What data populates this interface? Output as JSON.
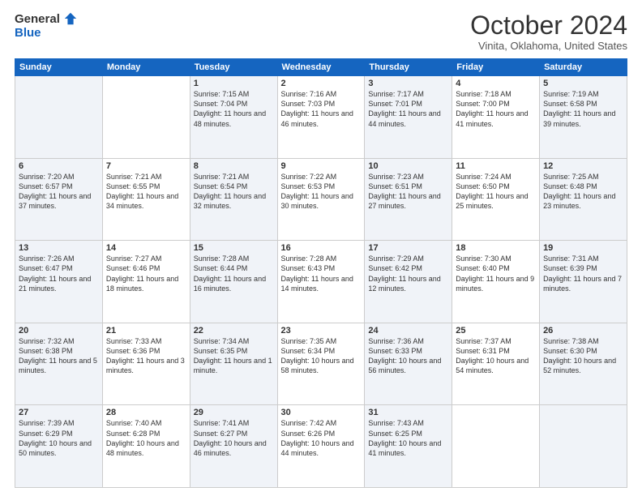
{
  "header": {
    "logo_general": "General",
    "logo_blue": "Blue",
    "title": "October 2024",
    "location": "Vinita, Oklahoma, United States"
  },
  "days_of_week": [
    "Sunday",
    "Monday",
    "Tuesday",
    "Wednesday",
    "Thursday",
    "Friday",
    "Saturday"
  ],
  "weeks": [
    [
      {
        "day": "",
        "info": ""
      },
      {
        "day": "",
        "info": ""
      },
      {
        "day": "1",
        "info": "Sunrise: 7:15 AM\nSunset: 7:04 PM\nDaylight: 11 hours and 48 minutes."
      },
      {
        "day": "2",
        "info": "Sunrise: 7:16 AM\nSunset: 7:03 PM\nDaylight: 11 hours and 46 minutes."
      },
      {
        "day": "3",
        "info": "Sunrise: 7:17 AM\nSunset: 7:01 PM\nDaylight: 11 hours and 44 minutes."
      },
      {
        "day": "4",
        "info": "Sunrise: 7:18 AM\nSunset: 7:00 PM\nDaylight: 11 hours and 41 minutes."
      },
      {
        "day": "5",
        "info": "Sunrise: 7:19 AM\nSunset: 6:58 PM\nDaylight: 11 hours and 39 minutes."
      }
    ],
    [
      {
        "day": "6",
        "info": "Sunrise: 7:20 AM\nSunset: 6:57 PM\nDaylight: 11 hours and 37 minutes."
      },
      {
        "day": "7",
        "info": "Sunrise: 7:21 AM\nSunset: 6:55 PM\nDaylight: 11 hours and 34 minutes."
      },
      {
        "day": "8",
        "info": "Sunrise: 7:21 AM\nSunset: 6:54 PM\nDaylight: 11 hours and 32 minutes."
      },
      {
        "day": "9",
        "info": "Sunrise: 7:22 AM\nSunset: 6:53 PM\nDaylight: 11 hours and 30 minutes."
      },
      {
        "day": "10",
        "info": "Sunrise: 7:23 AM\nSunset: 6:51 PM\nDaylight: 11 hours and 27 minutes."
      },
      {
        "day": "11",
        "info": "Sunrise: 7:24 AM\nSunset: 6:50 PM\nDaylight: 11 hours and 25 minutes."
      },
      {
        "day": "12",
        "info": "Sunrise: 7:25 AM\nSunset: 6:48 PM\nDaylight: 11 hours and 23 minutes."
      }
    ],
    [
      {
        "day": "13",
        "info": "Sunrise: 7:26 AM\nSunset: 6:47 PM\nDaylight: 11 hours and 21 minutes."
      },
      {
        "day": "14",
        "info": "Sunrise: 7:27 AM\nSunset: 6:46 PM\nDaylight: 11 hours and 18 minutes."
      },
      {
        "day": "15",
        "info": "Sunrise: 7:28 AM\nSunset: 6:44 PM\nDaylight: 11 hours and 16 minutes."
      },
      {
        "day": "16",
        "info": "Sunrise: 7:28 AM\nSunset: 6:43 PM\nDaylight: 11 hours and 14 minutes."
      },
      {
        "day": "17",
        "info": "Sunrise: 7:29 AM\nSunset: 6:42 PM\nDaylight: 11 hours and 12 minutes."
      },
      {
        "day": "18",
        "info": "Sunrise: 7:30 AM\nSunset: 6:40 PM\nDaylight: 11 hours and 9 minutes."
      },
      {
        "day": "19",
        "info": "Sunrise: 7:31 AM\nSunset: 6:39 PM\nDaylight: 11 hours and 7 minutes."
      }
    ],
    [
      {
        "day": "20",
        "info": "Sunrise: 7:32 AM\nSunset: 6:38 PM\nDaylight: 11 hours and 5 minutes."
      },
      {
        "day": "21",
        "info": "Sunrise: 7:33 AM\nSunset: 6:36 PM\nDaylight: 11 hours and 3 minutes."
      },
      {
        "day": "22",
        "info": "Sunrise: 7:34 AM\nSunset: 6:35 PM\nDaylight: 11 hours and 1 minute."
      },
      {
        "day": "23",
        "info": "Sunrise: 7:35 AM\nSunset: 6:34 PM\nDaylight: 10 hours and 58 minutes."
      },
      {
        "day": "24",
        "info": "Sunrise: 7:36 AM\nSunset: 6:33 PM\nDaylight: 10 hours and 56 minutes."
      },
      {
        "day": "25",
        "info": "Sunrise: 7:37 AM\nSunset: 6:31 PM\nDaylight: 10 hours and 54 minutes."
      },
      {
        "day": "26",
        "info": "Sunrise: 7:38 AM\nSunset: 6:30 PM\nDaylight: 10 hours and 52 minutes."
      }
    ],
    [
      {
        "day": "27",
        "info": "Sunrise: 7:39 AM\nSunset: 6:29 PM\nDaylight: 10 hours and 50 minutes."
      },
      {
        "day": "28",
        "info": "Sunrise: 7:40 AM\nSunset: 6:28 PM\nDaylight: 10 hours and 48 minutes."
      },
      {
        "day": "29",
        "info": "Sunrise: 7:41 AM\nSunset: 6:27 PM\nDaylight: 10 hours and 46 minutes."
      },
      {
        "day": "30",
        "info": "Sunrise: 7:42 AM\nSunset: 6:26 PM\nDaylight: 10 hours and 44 minutes."
      },
      {
        "day": "31",
        "info": "Sunrise: 7:43 AM\nSunset: 6:25 PM\nDaylight: 10 hours and 41 minutes."
      },
      {
        "day": "",
        "info": ""
      },
      {
        "day": "",
        "info": ""
      }
    ]
  ]
}
